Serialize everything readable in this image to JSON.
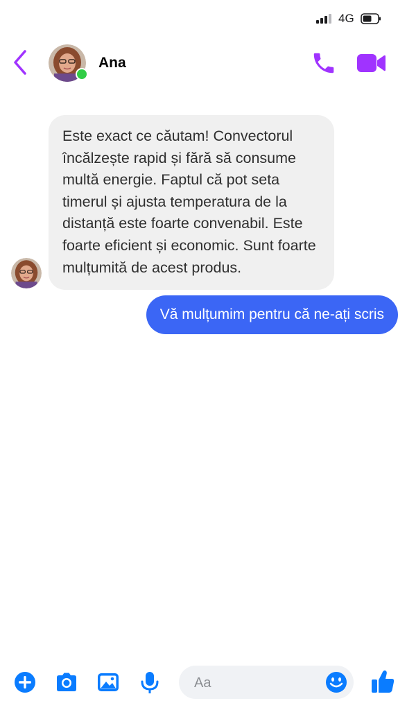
{
  "status_bar": {
    "network": "4G",
    "icons": [
      "signal-icon",
      "battery-icon"
    ]
  },
  "header": {
    "contact_name": "Ana",
    "online": true,
    "icons": [
      "back-icon",
      "phone-call-icon",
      "video-call-icon"
    ]
  },
  "messages": [
    {
      "direction": "incoming",
      "text": "Este exact ce căutam! Convectorul încălzește rapid și fără să consume multă energie. Faptul că pot seta timerul și ajusta temperatura de la distanță este foarte convenabil. Este foarte eficient și economic. Sunt foarte mulțumită de acest produs."
    },
    {
      "direction": "outgoing",
      "text": "Vă mulțumim pentru că ne-ați scris"
    }
  ],
  "composer": {
    "placeholder": "Aa",
    "value": "",
    "icons": [
      "plus-icon",
      "camera-icon",
      "gallery-icon",
      "microphone-icon",
      "emoji-icon",
      "like-icon"
    ]
  },
  "colors": {
    "accent_purple": "#a033ff",
    "outgoing_bubble": "#3b66f5",
    "incoming_bubble": "#f0f0f0",
    "composer_blue": "#0a7cff",
    "online_green": "#31cc46"
  }
}
